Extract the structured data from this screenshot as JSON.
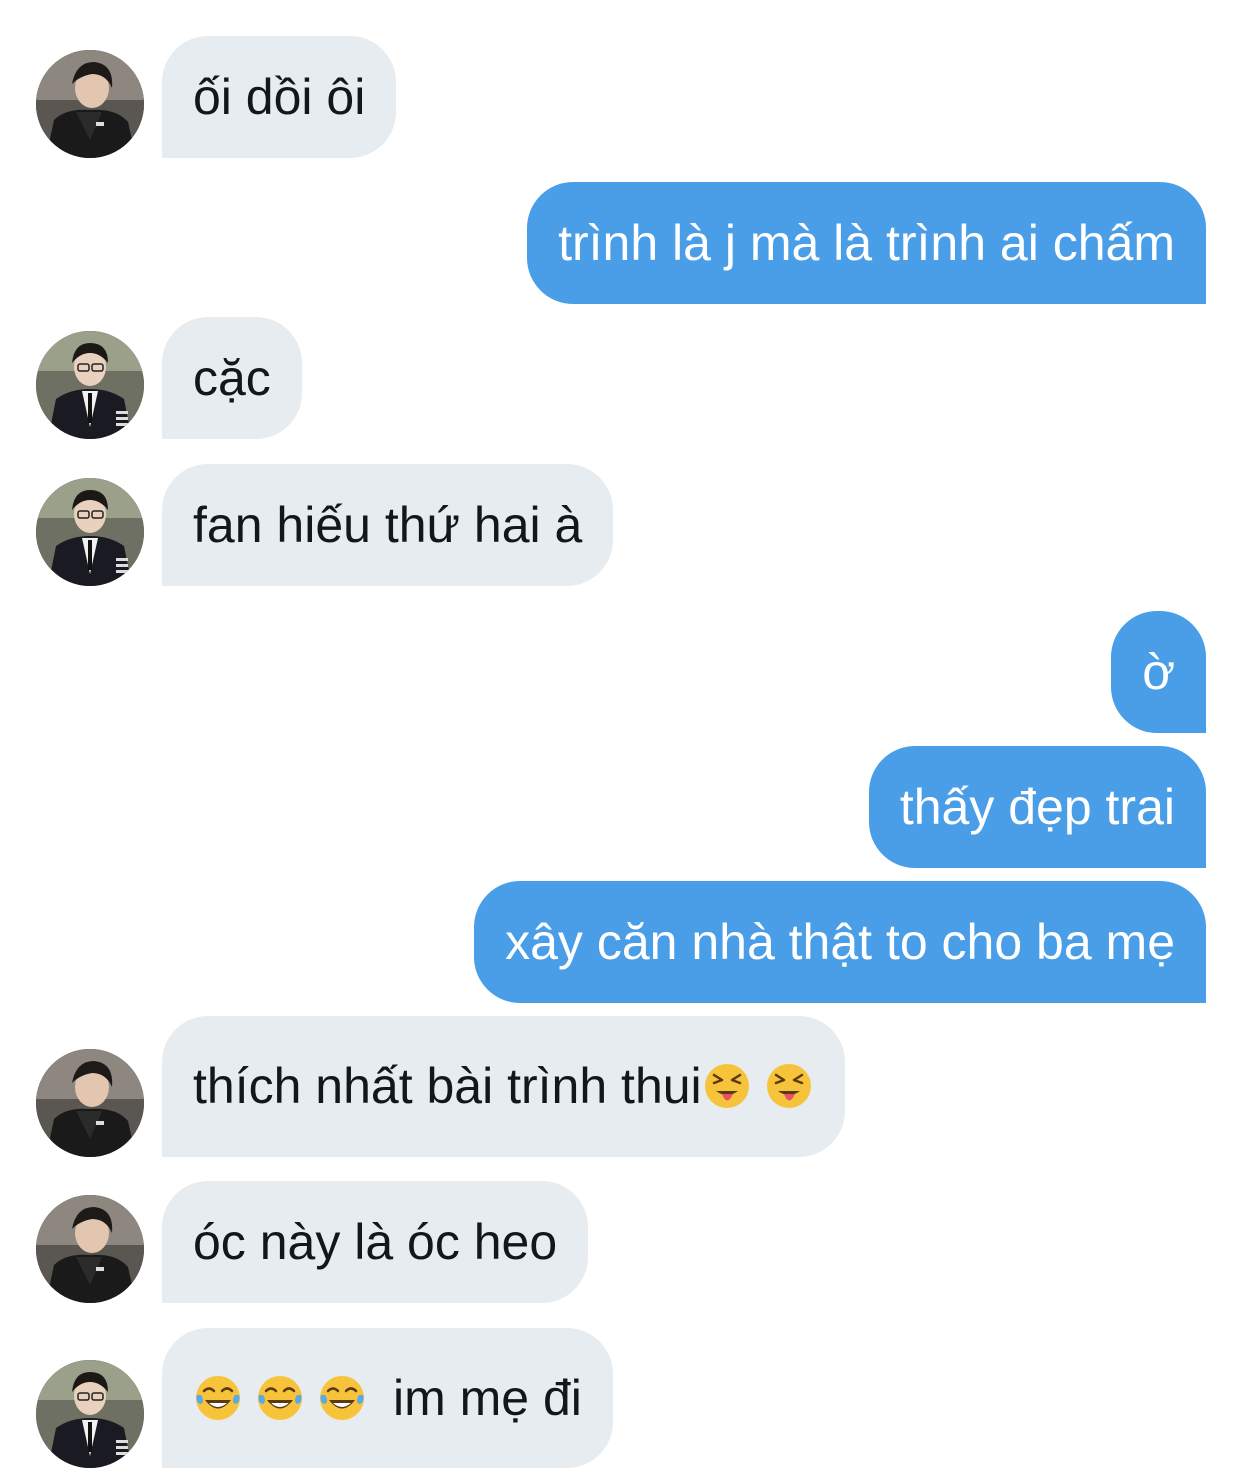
{
  "conversation": {
    "messages": [
      {
        "sender": "them",
        "avatar": "avatar-jacket",
        "text": "ối dồi ôi"
      },
      {
        "sender": "me",
        "text": "trình là j mà là trình ai chấm"
      },
      {
        "sender": "them",
        "avatar": "avatar-suit-glasses",
        "text": "cặc"
      },
      {
        "sender": "them",
        "avatar": "avatar-suit-glasses",
        "text": "fan hiếu thứ hai à"
      },
      {
        "sender": "me",
        "text": "ờ"
      },
      {
        "sender": "me",
        "text": "thấy đẹp trai"
      },
      {
        "sender": "me",
        "text": "xây căn nhà thật to cho ba mẹ"
      },
      {
        "sender": "them",
        "avatar": "avatar-jacket",
        "text": "thích nhất bài trình thui",
        "emoji_after": [
          "squinting-face-with-tongue",
          "squinting-face-with-tongue"
        ]
      },
      {
        "sender": "them",
        "avatar": "avatar-jacket",
        "text": "óc này là óc heo"
      },
      {
        "sender": "them",
        "avatar": "avatar-suit-glasses",
        "emoji_before": [
          "face-with-tears-of-joy",
          "face-with-tears-of-joy",
          "face-with-tears-of-joy"
        ],
        "text": "im mẹ đi"
      }
    ]
  },
  "colors": {
    "incoming_bubble": "#e6ecf0",
    "outgoing_bubble": "#4a9ee8",
    "incoming_text": "#14171a",
    "outgoing_text": "#ffffff"
  }
}
